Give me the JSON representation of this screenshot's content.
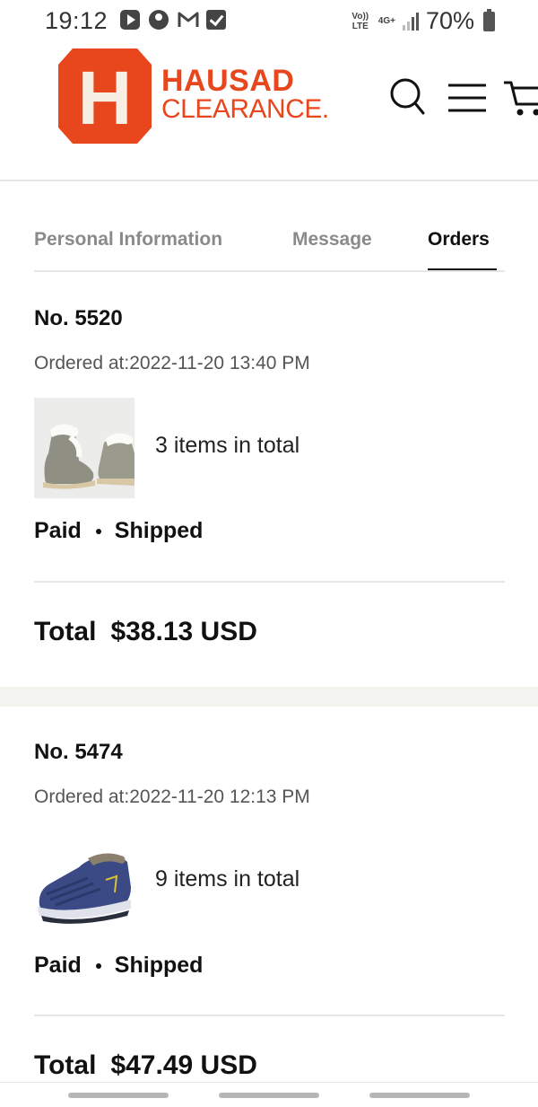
{
  "status_bar": {
    "time": "19:12",
    "network_top": "Vo)) LTE",
    "network_4g": "4G+",
    "battery_percent": "70%",
    "icons": [
      "youtube-icon",
      "account-icon",
      "gmail-icon",
      "checkbox-icon",
      "signal-icon",
      "battery-icon"
    ]
  },
  "header": {
    "logo_letter": "H",
    "logo_line1": "HAUSAD",
    "logo_line2": "CLEARANCE.",
    "brand_color": "#e8461d",
    "icons": [
      "search-icon",
      "menu-icon",
      "cart-icon"
    ]
  },
  "tabs": [
    {
      "label": "Personal Information",
      "active": false
    },
    {
      "label": "Message",
      "active": false
    },
    {
      "label": "Orders",
      "active": true
    }
  ],
  "orders": [
    {
      "number": "No. 5520",
      "ordered_at": "Ordered at:2022-11-20 13:40 PM",
      "items_text": "3 items in total",
      "payment_status": "Paid",
      "shipping_status": "Shipped",
      "total_label": "Total",
      "total_value": "$38.13 USD",
      "thumbnail": "grey suede fur-lined boots"
    },
    {
      "number": "No. 5474",
      "ordered_at": "Ordered at:2022-11-20 12:13 PM",
      "items_text": "9 items in total",
      "payment_status": "Paid",
      "shipping_status": "Shipped",
      "total_label": "Total",
      "total_value": "$47.49 USD",
      "thumbnail": "navy quilted snow shoe"
    }
  ]
}
